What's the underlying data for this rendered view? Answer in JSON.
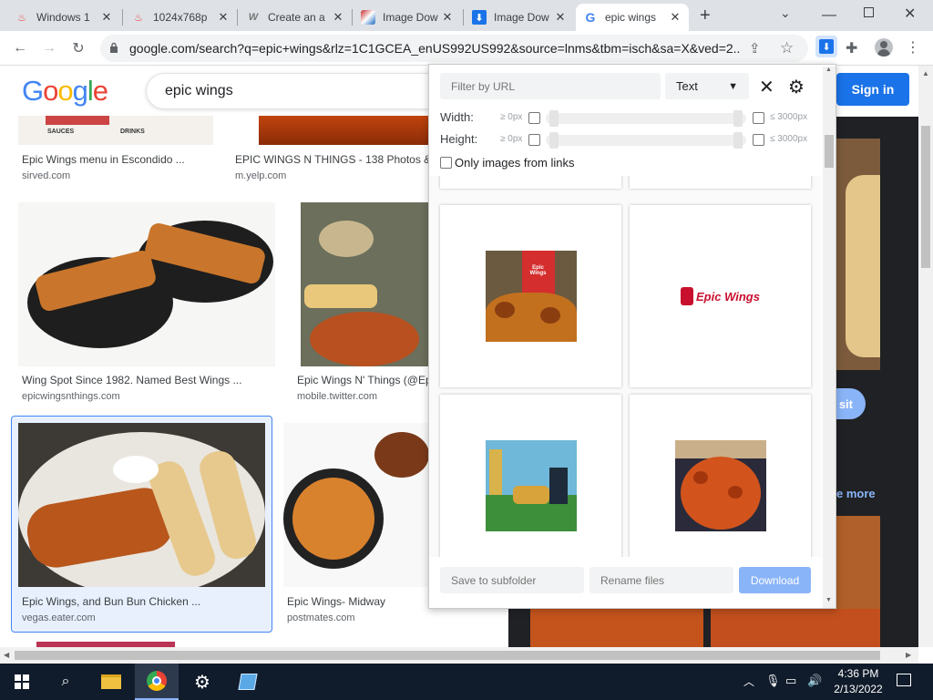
{
  "tabs": [
    {
      "label": "Windows 1"
    },
    {
      "label": "1024x768p"
    },
    {
      "label": "Create an a"
    },
    {
      "label": "Image Dow"
    },
    {
      "label": "Image Dow"
    },
    {
      "label": "epic wings"
    }
  ],
  "url": "google.com/search?q=epic+wings&rlz=1C1GCEA_enUS992US992&source=lnms&tbm=isch&sa=X&ved=2...",
  "google": {
    "logo": "Google",
    "query": "epic wings",
    "signin": "Sign in",
    "visit_fragment": "sit",
    "more_fragment": "e more"
  },
  "results": [
    {
      "title": "Epic Wings menu in Escondido ...",
      "source": "sirved.com"
    },
    {
      "title": "EPIC WINGS N THINGS - 138 Photos &",
      "source": "m.yelp.com"
    },
    {
      "title": "Wing Spot Since 1982. Named Best Wings ...",
      "source": "epicwingsnthings.com"
    },
    {
      "title": "Epic Wings N' Things (@Ep",
      "source": "mobile.twitter.com"
    },
    {
      "title": "Epic Wings, and Bun Bun Chicken ...",
      "source": "vegas.eater.com"
    },
    {
      "title": "Epic Wings- Midway",
      "source": "postmates.com"
    }
  ],
  "thumb_text": {
    "sauces": "SAUCES",
    "drinks": "DRINKS"
  },
  "popup": {
    "filter_placeholder": "Filter by URL",
    "type_select": "Text",
    "width_label": "Width:",
    "height_label": "Height:",
    "min_label": "≥ 0px",
    "max_label": "≤ 3000px",
    "only_links_label": "Only images from links",
    "epic_logo_text": "Epic Wings",
    "cup_text": "Epic Wings",
    "subfolder_placeholder": "Save to subfolder",
    "rename_placeholder": "Rename files",
    "download_label": "Download"
  },
  "taskbar": {
    "time": "4:36 PM",
    "date": "2/13/2022"
  },
  "colors": {
    "google_blue": "#1a73e8",
    "download_btn": "#8ab4f8",
    "taskbar": "#101b2b"
  }
}
